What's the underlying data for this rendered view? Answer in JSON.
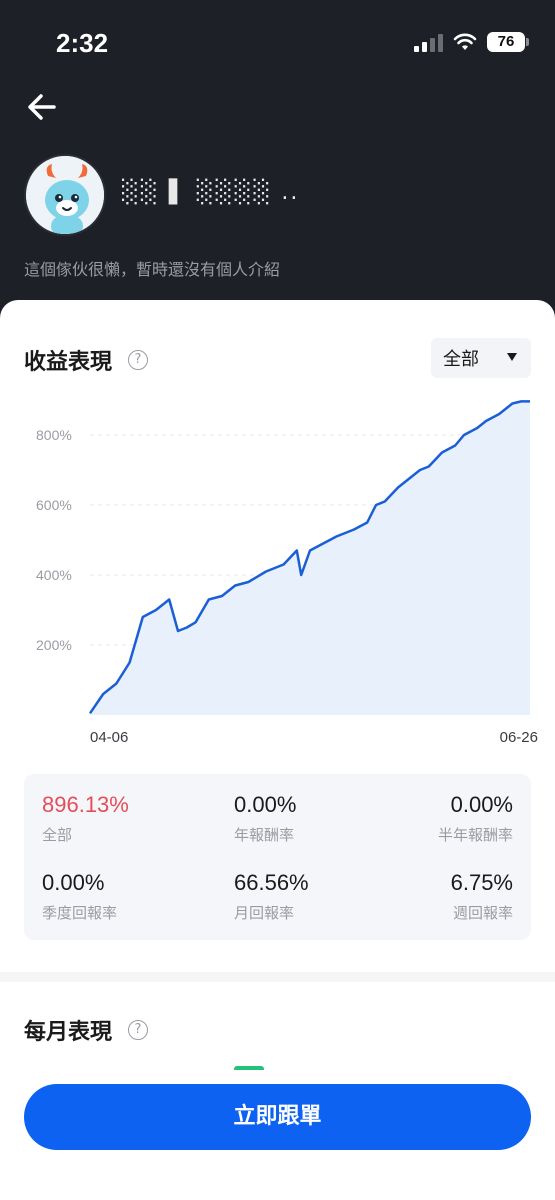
{
  "status": {
    "time": "2:32",
    "battery": "76"
  },
  "profile": {
    "username": "░░ ▌ ░░░░ ..",
    "bio": "這個傢伙很懶，暫時還沒有個人介紹"
  },
  "performance": {
    "title": "收益表現",
    "range_selected": "全部"
  },
  "chart_data": {
    "type": "area",
    "x_tick_labels": [
      "04-06",
      "06-26"
    ],
    "y_tick_labels": [
      "200%",
      "400%",
      "600%",
      "800%"
    ],
    "ylim": [
      0,
      900
    ],
    "grid": true,
    "x": [
      0,
      3,
      6,
      9,
      12,
      15,
      18,
      20,
      22,
      24,
      27,
      30,
      33,
      36,
      40,
      44,
      47,
      48,
      50,
      53,
      56,
      60,
      63,
      65,
      67,
      70,
      75,
      77,
      80,
      83,
      85,
      88,
      90,
      93,
      95,
      96,
      98,
      100
    ],
    "values": [
      5,
      60,
      90,
      150,
      280,
      300,
      330,
      240,
      250,
      265,
      330,
      340,
      370,
      380,
      410,
      430,
      470,
      400,
      470,
      490,
      510,
      530,
      550,
      600,
      610,
      650,
      700,
      710,
      750,
      770,
      800,
      820,
      840,
      860,
      880,
      890,
      896,
      896
    ]
  },
  "stats": [
    {
      "value": "896.13%",
      "label": "全部"
    },
    {
      "value": "0.00%",
      "label": "年報酬率"
    },
    {
      "value": "0.00%",
      "label": "半年報酬率"
    },
    {
      "value": "0.00%",
      "label": "季度回報率"
    },
    {
      "value": "66.56%",
      "label": "月回報率"
    },
    {
      "value": "6.75%",
      "label": "週回報率"
    }
  ],
  "monthly": {
    "title": "每月表現"
  },
  "cta": {
    "label": "立即跟單"
  },
  "help_glyph": "?",
  "colors": {
    "accent": "#0d62f2",
    "positive": "#e34e5a",
    "line": "#1a5fd6",
    "bar": "#22c27a"
  }
}
